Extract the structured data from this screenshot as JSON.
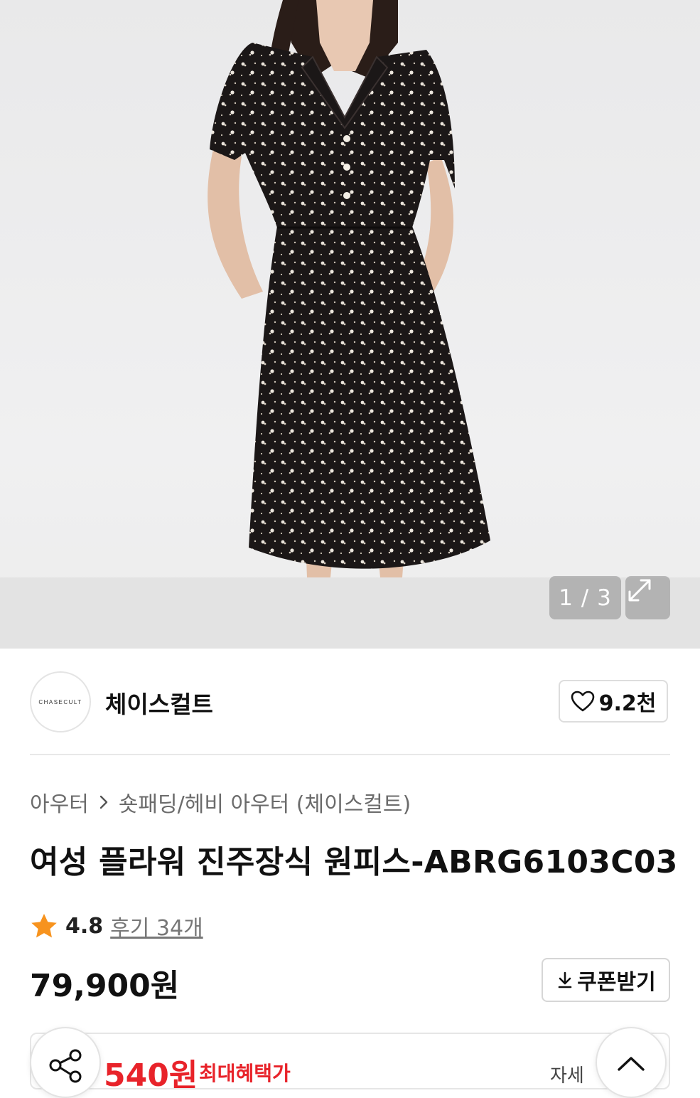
{
  "gallery": {
    "counter": "1 / 3",
    "expand_icon": "expand-icon"
  },
  "brand": {
    "logo_text": "CHASECULT",
    "name": "체이스컬트",
    "like_icon": "heart-icon",
    "like_count": "9.2천"
  },
  "breadcrumb": {
    "category": "아우터",
    "subcategory": "숏패딩/헤비 아우터 (체이스컬트)"
  },
  "product": {
    "title": "여성 플라워 진주장식 원피스-ABRG6103C03",
    "rating": "4.8",
    "reviews": "후기 34개",
    "price": "79,900원"
  },
  "coupon": {
    "label": "쿠폰받기",
    "icon": "download-icon"
  },
  "benefit": {
    "price": "540원",
    "label": "최대혜택가",
    "detail": "자세"
  },
  "colors": {
    "accent_red": "#e8232a",
    "star": "#f7931e"
  }
}
